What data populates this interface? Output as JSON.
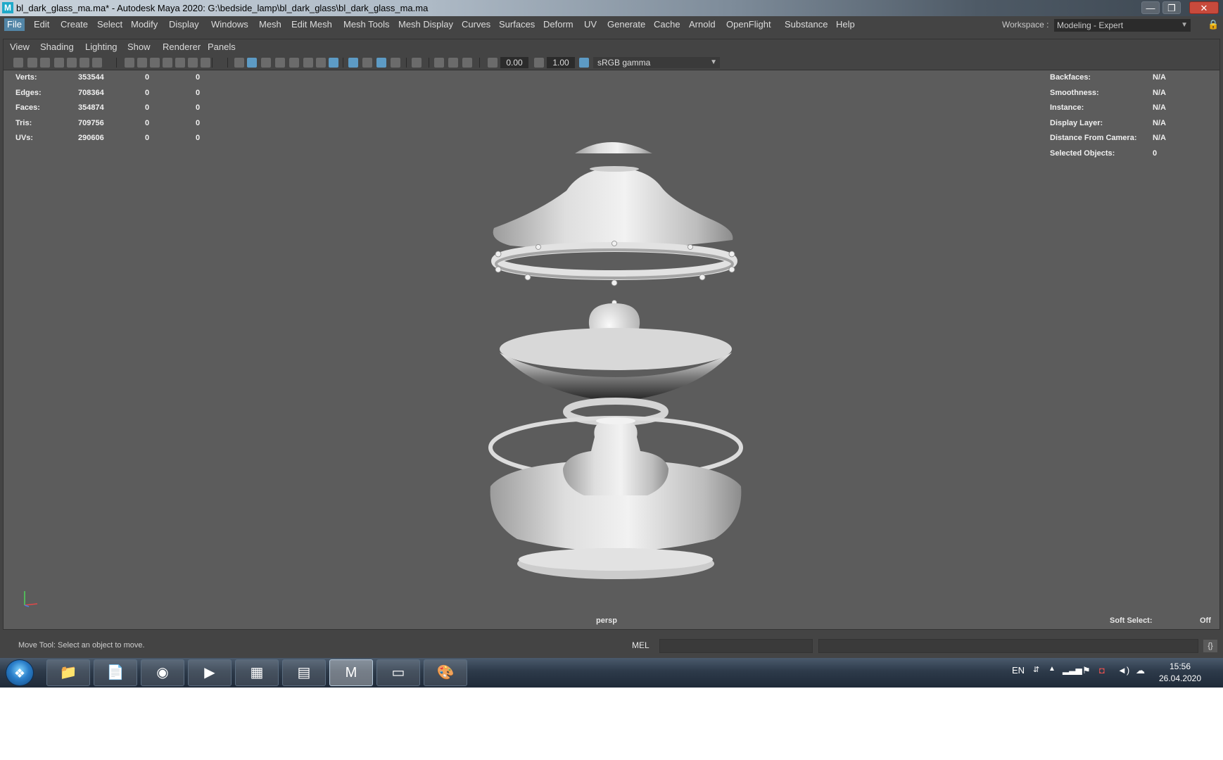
{
  "window": {
    "title": "bl_dark_glass_ma.ma* - Autodesk Maya 2020: G:\\bedside_lamp\\bl_dark_glass\\bl_dark_glass_ma.ma",
    "logo": "M",
    "minimize": "—",
    "restore": "❐",
    "close": "✕"
  },
  "menubar": {
    "items": [
      "File",
      "Edit",
      "Create",
      "Select",
      "Modify",
      "Display",
      "Windows",
      "Mesh",
      "Edit Mesh",
      "Mesh Tools",
      "Mesh Display",
      "Curves",
      "Surfaces",
      "Deform",
      "UV",
      "Generate",
      "Cache",
      "Arnold",
      "OpenFlight",
      "Substance",
      "Help"
    ],
    "active": "File",
    "workspace_label": "Workspace :",
    "workspace_value": "Modeling - Expert",
    "dropdown_arrow": "▼",
    "lock_icon": "🔒"
  },
  "panel": {
    "menu": [
      "View",
      "Shading",
      "Lighting",
      "Show",
      "Renderer",
      "Panels"
    ],
    "toolbar": {
      "exposure": "0.00",
      "gamma": "1.00",
      "color_space": "sRGB gamma",
      "dropdown_arrow": "▼"
    }
  },
  "hud": {
    "left": [
      {
        "label": "Verts:",
        "v1": "353544",
        "v2": "0",
        "v3": "0"
      },
      {
        "label": "Edges:",
        "v1": "708364",
        "v2": "0",
        "v3": "0"
      },
      {
        "label": "Faces:",
        "v1": "354874",
        "v2": "0",
        "v3": "0"
      },
      {
        "label": "Tris:",
        "v1": "709756",
        "v2": "0",
        "v3": "0"
      },
      {
        "label": "UVs:",
        "v1": "290606",
        "v2": "0",
        "v3": "0"
      }
    ],
    "right": [
      {
        "label": "Backfaces:",
        "value": "N/A"
      },
      {
        "label": "Smoothness:",
        "value": "N/A"
      },
      {
        "label": "Instance:",
        "value": "N/A"
      },
      {
        "label": "Display Layer:",
        "value": "N/A"
      },
      {
        "label": "Distance From Camera:",
        "value": "N/A"
      },
      {
        "label": "Selected Objects:",
        "value": "0"
      }
    ],
    "camera": "persp",
    "soft_select_label": "Soft Select:",
    "soft_select_value": "Off"
  },
  "helpline": {
    "text": "Move Tool: Select an object to move.",
    "mel": "MEL"
  },
  "taskbar": {
    "start_icon": "❖",
    "apps": [
      {
        "name": "file-explorer-icon",
        "glyph": "📁"
      },
      {
        "name": "notepad-icon",
        "glyph": "📄"
      },
      {
        "name": "chrome-icon",
        "glyph": "◉"
      },
      {
        "name": "media-player-icon",
        "glyph": "▶"
      },
      {
        "name": "calculator-icon",
        "glyph": "▦"
      },
      {
        "name": "winrar-icon",
        "glyph": "▤"
      },
      {
        "name": "maya-icon",
        "glyph": "M"
      },
      {
        "name": "photo-viewer-icon",
        "glyph": "▭"
      },
      {
        "name": "paint-icon",
        "glyph": "🎨"
      }
    ],
    "active_app": "maya-icon",
    "language": "EN",
    "time": "15:56",
    "date": "26.04.2020"
  },
  "colors": {
    "menu_active": "#5285a6",
    "viewport_bg": "#5c5c5c",
    "toolbar_active": "#5d9bc5"
  }
}
